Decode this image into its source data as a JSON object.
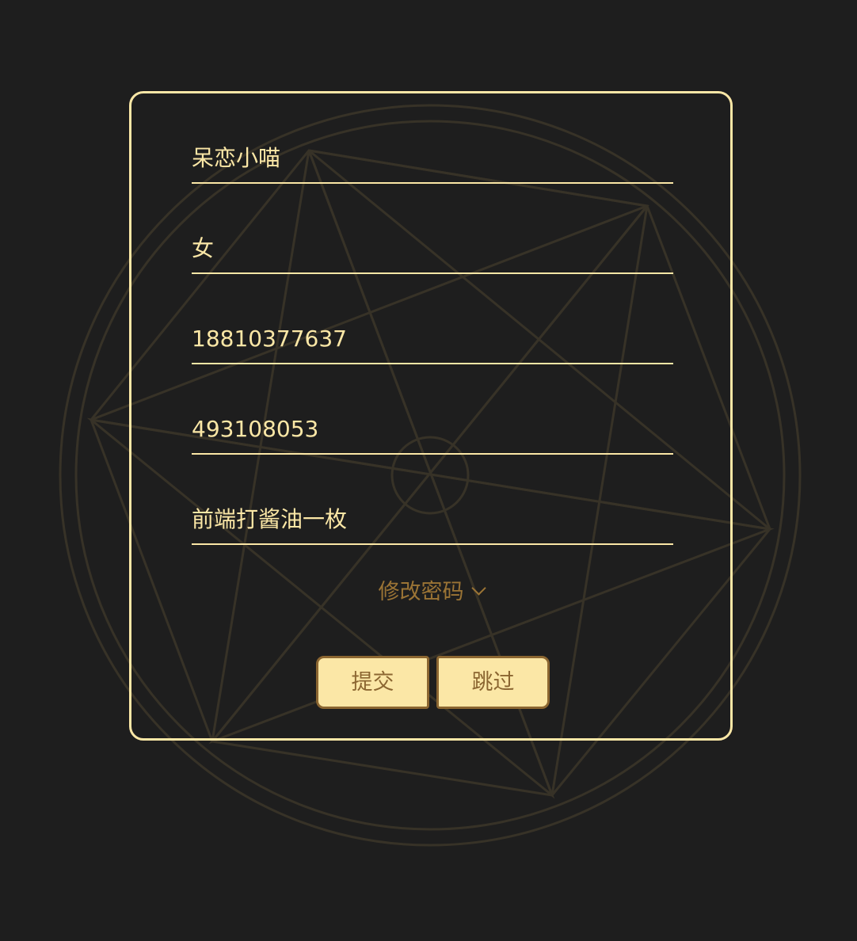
{
  "colors": {
    "background": "#1e1e1e",
    "accent": "#fbe7a6",
    "accent_dark": "#8b6631",
    "link": "#9b7435"
  },
  "form": {
    "nickname": {
      "value": "呆恋小喵"
    },
    "gender": {
      "value": "女"
    },
    "phone": {
      "value": "18810377637"
    },
    "qq": {
      "value": "493108053"
    },
    "bio": {
      "value": "前端打酱油一枚"
    }
  },
  "password_toggle": {
    "label": "修改密码",
    "icon": "chevron-down-icon"
  },
  "actions": {
    "submit_label": "提交",
    "skip_label": "跳过"
  }
}
